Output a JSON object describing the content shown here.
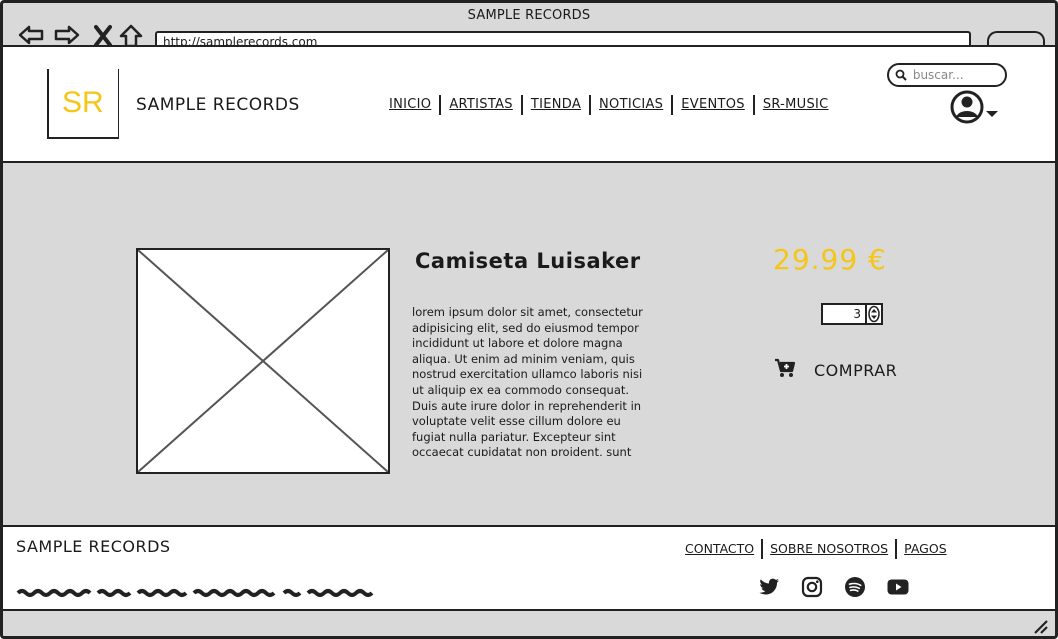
{
  "window": {
    "title": "SAMPLE RECORDS",
    "address": "http://samplerecords.com"
  },
  "header": {
    "logo_text": "SR",
    "site_name": "SAMPLE RECORDS",
    "nav": [
      {
        "label": "INICIO"
      },
      {
        "label": "ARTISTAS"
      },
      {
        "label": "TIENDA"
      },
      {
        "label": "NOTICIAS"
      },
      {
        "label": "EVENTOS"
      },
      {
        "label": "SR-MUSIC"
      }
    ],
    "search_placeholder": "buscar..."
  },
  "product": {
    "title": "Camiseta Luisaker",
    "description": "lorem ipsum dolor sit amet, consectetur adipisicing elit, sed do eiusmod tempor incididunt ut labore et dolore magna aliqua. Ut enim ad minim veniam, quis nostrud exercitation ullamco laboris nisi ut aliquip ex ea commodo consequat. Duis aute irure dolor in reprehenderit in voluptate velit esse cillum dolore eu fugiat nulla pariatur. Excepteur sint occaecat cupidatat non proident, sunt",
    "price": "29.99 €",
    "quantity": "3",
    "buy_label": "COMPRAR"
  },
  "footer": {
    "site_name": "SAMPLE RECORDS",
    "links": [
      {
        "label": "CONTACTO"
      },
      {
        "label": "SOBRE NOSOTROS"
      },
      {
        "label": "PAGOS"
      }
    ],
    "social_icons": [
      "twitter-icon",
      "instagram-icon",
      "spotify-icon",
      "youtube-icon"
    ]
  },
  "colors": {
    "accent": "#f5c518",
    "background": "#d9d9d9",
    "ink": "#222222"
  }
}
